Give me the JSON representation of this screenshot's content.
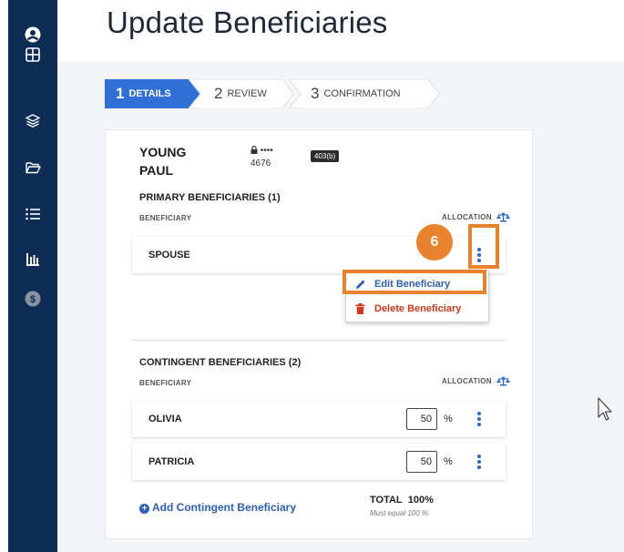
{
  "page": {
    "title": "Update Beneficiaries"
  },
  "sidebar": {
    "items": [
      {
        "icon": "user-circle-icon"
      },
      {
        "icon": "grid-icon"
      },
      {
        "icon": "layers-icon"
      },
      {
        "icon": "folder-icon"
      },
      {
        "icon": "list-icon"
      },
      {
        "icon": "bar-chart-icon"
      },
      {
        "icon": "dollar-icon"
      }
    ]
  },
  "stepper": {
    "steps": [
      {
        "number": "1",
        "label": "DETAILS",
        "active": true
      },
      {
        "number": "2",
        "label": "REVIEW",
        "active": false
      },
      {
        "number": "3",
        "label": "CONFIRMATION",
        "active": false
      }
    ]
  },
  "account": {
    "first_line": "YOUNG",
    "second_line": "PAUL",
    "masked": "••••",
    "number": "4676",
    "type": "403(b)"
  },
  "primary": {
    "title": "PRIMARY BENEFICIARIES (1)",
    "col_beneficiary": "BENEFICIARY",
    "col_allocation": "ALLOCATION",
    "rows": [
      {
        "name": "SPOUSE"
      }
    ]
  },
  "menu": {
    "edit_label": "Edit Beneficiary",
    "delete_label": "Delete Beneficiary"
  },
  "callout": {
    "step": "6"
  },
  "contingent": {
    "title": "CONTINGENT BENEFICIARIES (2)",
    "col_beneficiary": "BENEFICIARY",
    "col_allocation": "ALLOCATION",
    "rows": [
      {
        "name": "OLIVIA",
        "allocation": "50",
        "unit": "%"
      },
      {
        "name": "PATRICIA",
        "allocation": "50",
        "unit": "%"
      }
    ]
  },
  "footer": {
    "add_label": "Add Contingent Beneficiary",
    "total_label": "TOTAL",
    "total_value": "100%",
    "total_note": "Must equal 100 %"
  },
  "colors": {
    "sidebar": "#0d2d54",
    "accent": "#2c5fb7",
    "highlight": "#e8822c",
    "delete": "#cc3a1b"
  }
}
